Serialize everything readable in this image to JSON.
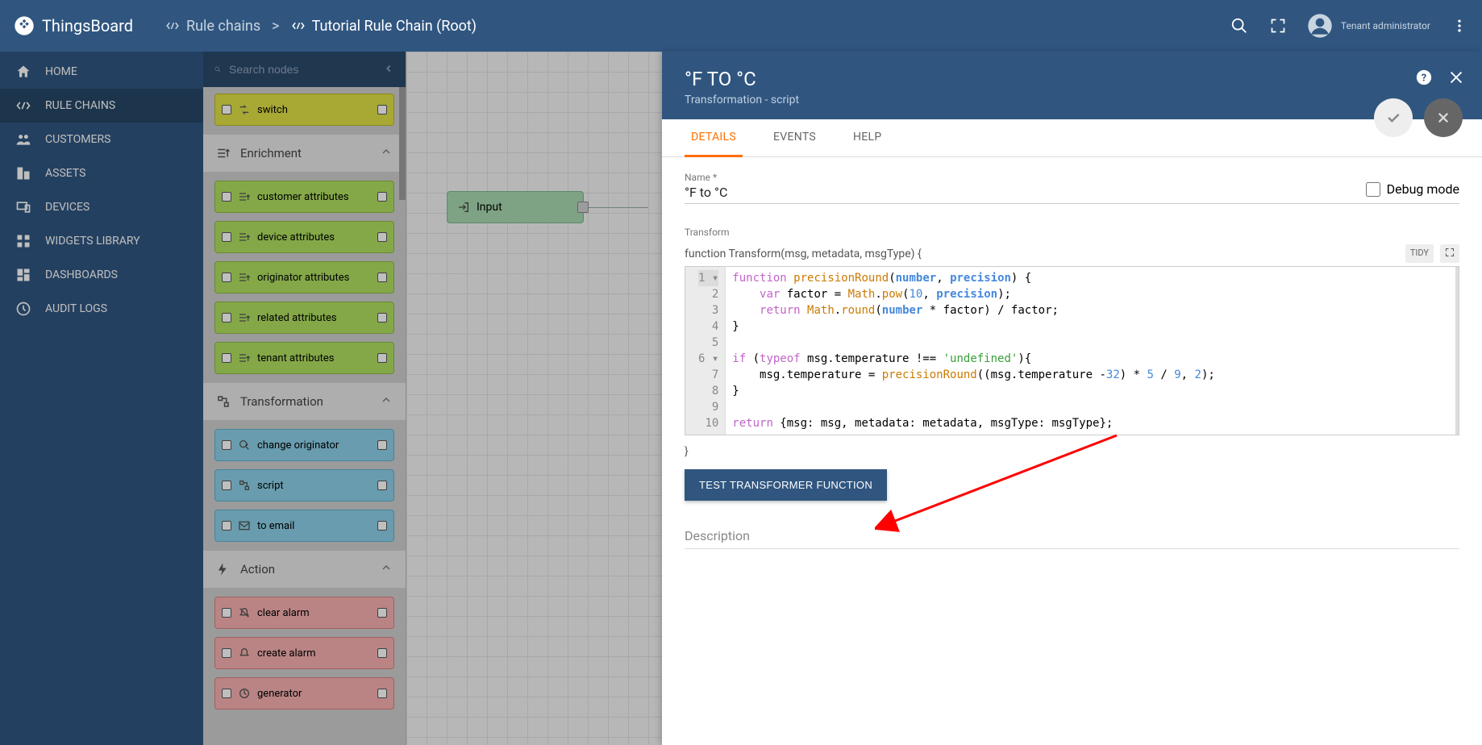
{
  "brand": "ThingsBoard",
  "breadcrumb": {
    "parent": "Rule chains",
    "separator": ">",
    "current": "Tutorial Rule Chain (Root)"
  },
  "user": {
    "name": "Tenant administrator"
  },
  "sidebar": {
    "items": [
      {
        "label": "HOME",
        "icon": "home"
      },
      {
        "label": "RULE CHAINS",
        "icon": "rulechain",
        "active": true
      },
      {
        "label": "CUSTOMERS",
        "icon": "people"
      },
      {
        "label": "ASSETS",
        "icon": "domain"
      },
      {
        "label": "DEVICES",
        "icon": "devices"
      },
      {
        "label": "WIDGETS LIBRARY",
        "icon": "widgets"
      },
      {
        "label": "DASHBOARDS",
        "icon": "dashboard"
      },
      {
        "label": "AUDIT LOGS",
        "icon": "track"
      }
    ]
  },
  "nodesPanel": {
    "searchPlaceholder": "Search nodes",
    "filterItems": [
      {
        "label": "switch",
        "color": "yellow"
      }
    ],
    "sections": [
      {
        "title": "Enrichment",
        "icon": "enrich",
        "items": [
          {
            "label": "customer attributes",
            "color": "green"
          },
          {
            "label": "device attributes",
            "color": "green"
          },
          {
            "label": "originator attributes",
            "color": "green"
          },
          {
            "label": "related attributes",
            "color": "green"
          },
          {
            "label": "tenant attributes",
            "color": "green"
          }
        ]
      },
      {
        "title": "Transformation",
        "icon": "transform",
        "items": [
          {
            "label": "change originator",
            "color": "blue"
          },
          {
            "label": "script",
            "color": "blue"
          },
          {
            "label": "to email",
            "color": "blue"
          }
        ]
      },
      {
        "title": "Action",
        "icon": "action",
        "items": [
          {
            "label": "clear alarm",
            "color": "red"
          },
          {
            "label": "create alarm",
            "color": "red"
          },
          {
            "label": "generator",
            "color": "red"
          }
        ]
      }
    ]
  },
  "canvas": {
    "inputLabel": "Input"
  },
  "detail": {
    "title": "°F TO °C",
    "subtitle": "Transformation - script",
    "tabs": [
      {
        "label": "DETAILS",
        "active": true
      },
      {
        "label": "EVENTS"
      },
      {
        "label": "HELP"
      }
    ],
    "fields": {
      "nameLabel": "Name *",
      "nameValue": "°F to °C",
      "debugLabel": "Debug mode"
    },
    "transformLabel": "Transform",
    "fnSig": "function Transform(msg, metadata, msgType) {",
    "tidyLabel": "TIDY",
    "closeBrace": "}",
    "code": {
      "lines": [
        "function precisionRound(number, precision) {",
        "    var factor = Math.pow(10, precision);",
        "    return Math.round(number * factor) / factor;",
        "}",
        "",
        "if (typeof msg.temperature !== 'undefined'){",
        "    msg.temperature = precisionRound((msg.temperature -32) * 5 / 9, 2);",
        "}",
        "",
        "return {msg: msg, metadata: metadata, msgType: msgType};"
      ]
    },
    "testBtn": "TEST TRANSFORMER FUNCTION",
    "descLabel": "Description"
  }
}
